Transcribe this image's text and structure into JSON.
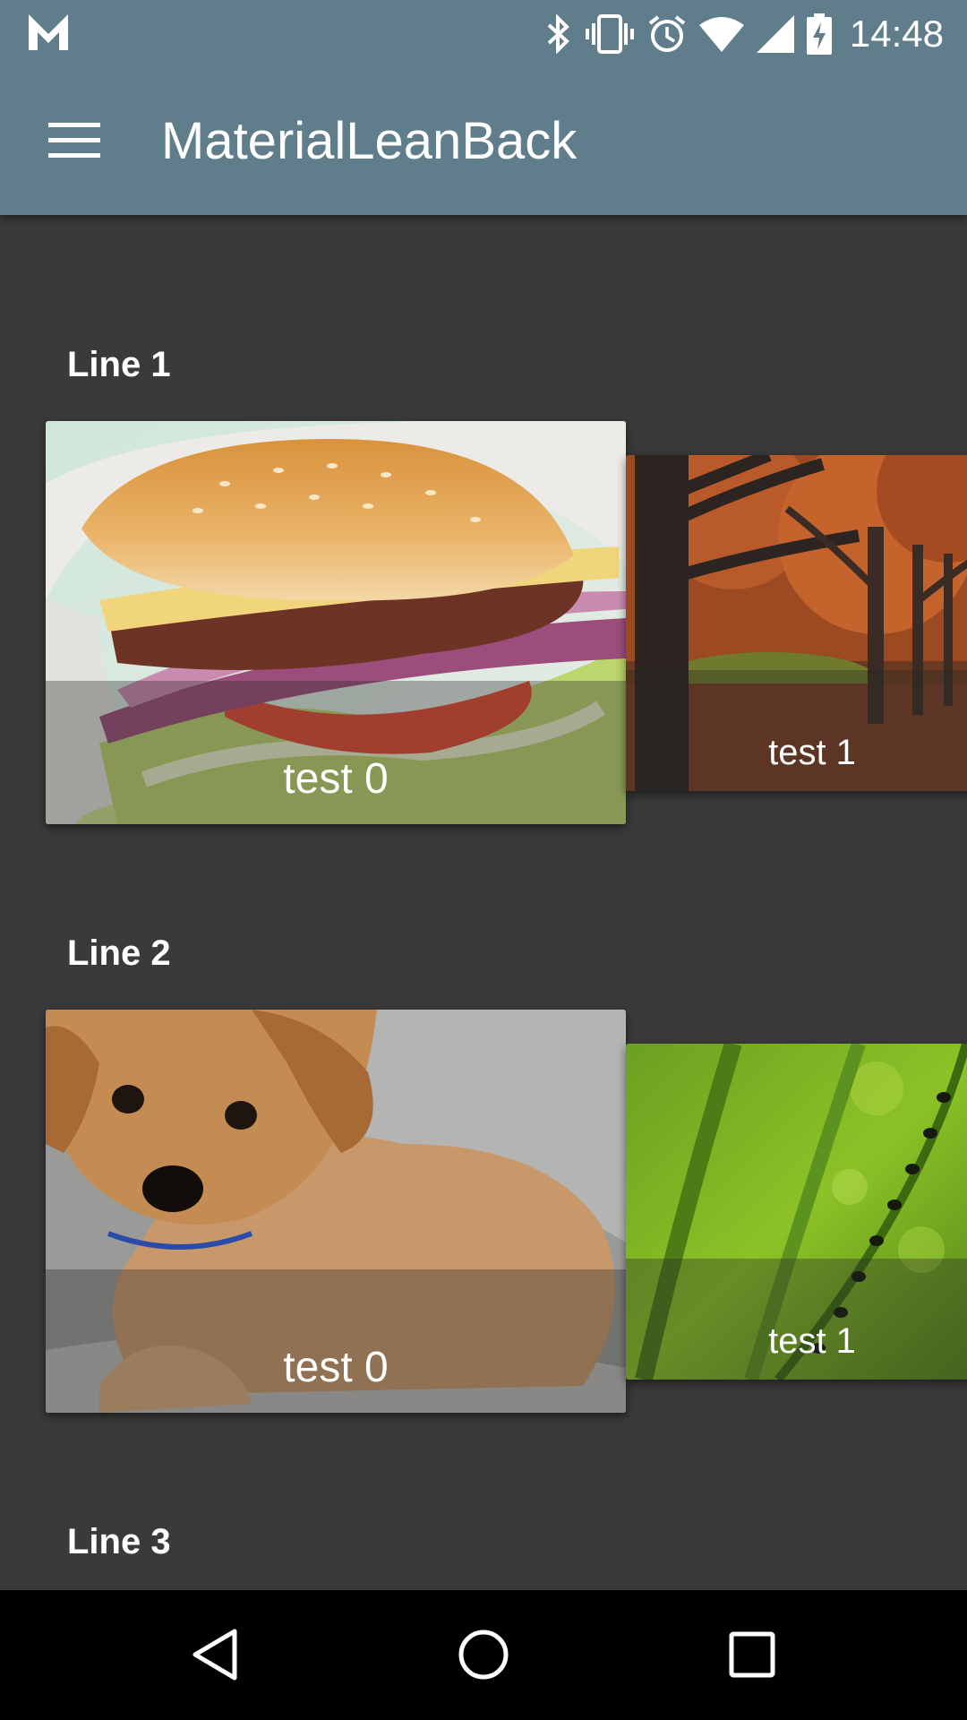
{
  "status_bar": {
    "time": "14:48",
    "icons": [
      "gmail-icon",
      "bluetooth-icon",
      "vibrate-icon",
      "alarm-icon",
      "wifi-icon",
      "signal-icon",
      "battery-charging-icon"
    ]
  },
  "toolbar": {
    "menu_icon": "hamburger-menu-icon",
    "title": "MaterialLeanBack"
  },
  "rows": [
    {
      "label": "Line 1",
      "cards": [
        {
          "caption": "test 0",
          "image": "burger-photo"
        },
        {
          "caption": "test 1",
          "image": "autumn-trees-photo"
        }
      ]
    },
    {
      "label": "Line 2",
      "cards": [
        {
          "caption": "test 0",
          "image": "puppy-photo"
        },
        {
          "caption": "test 1",
          "image": "grass-ants-photo"
        }
      ]
    },
    {
      "label": "Line 3",
      "cards": []
    }
  ],
  "nav_bar": {
    "icons": [
      "back-icon",
      "home-icon",
      "recents-icon"
    ]
  },
  "colors": {
    "toolbar": "#607d8b",
    "background": "#3a3a3a",
    "nav_bar": "#000000"
  }
}
